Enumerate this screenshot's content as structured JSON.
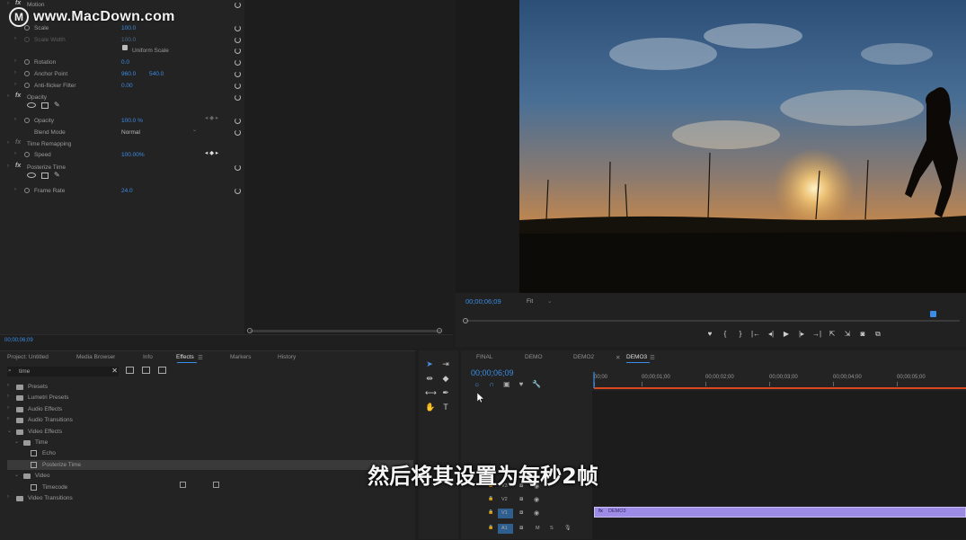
{
  "watermark": {
    "text": "www.MacDown.com"
  },
  "subtitle": "然后将其设置为每秒2帧",
  "effect_controls": {
    "rows": [
      {
        "label": "Motion",
        "value": "",
        "value2": ""
      },
      {
        "label": "Scale",
        "value": "100.0",
        "value2": ""
      },
      {
        "label": "Scale Width",
        "value": "100.0",
        "value2": ""
      },
      {
        "label": "Uniform Scale",
        "value": "",
        "value2": ""
      },
      {
        "label": "Rotation",
        "value": "0.0",
        "value2": ""
      },
      {
        "label": "Anchor Point",
        "value": "960.0",
        "value2": "540.0"
      },
      {
        "label": "Anti-flicker Filter",
        "value": "0.00",
        "value2": ""
      },
      {
        "label": "Opacity",
        "value": "",
        "value2": ""
      },
      {
        "label": "Opacity",
        "value": "100.0 %",
        "value2": ""
      },
      {
        "label": "Blend Mode",
        "value": "Normal",
        "value2": ""
      },
      {
        "label": "Time Remapping",
        "value": "",
        "value2": ""
      },
      {
        "label": "Speed",
        "value": "100.00%",
        "value2": ""
      },
      {
        "label": "Posterize Time",
        "value": "",
        "value2": ""
      },
      {
        "label": "Frame Rate",
        "value": "24.0",
        "value2": ""
      }
    ],
    "timecode": "00;00;06;09"
  },
  "program_monitor": {
    "timecode": "00;00;06;09",
    "fit_label": "Fit"
  },
  "project_panel": {
    "tabs": [
      "Project: Untitled",
      "Media Browser",
      "Info",
      "Effects",
      "Markers",
      "History"
    ],
    "search_value": "time",
    "tree": [
      {
        "label": "Presets",
        "indent": 0,
        "type": "folder"
      },
      {
        "label": "Lumetri Presets",
        "indent": 0,
        "type": "folder"
      },
      {
        "label": "Audio Effects",
        "indent": 0,
        "type": "folder"
      },
      {
        "label": "Audio Transitions",
        "indent": 0,
        "type": "folder"
      },
      {
        "label": "Video Effects",
        "indent": 0,
        "type": "folder"
      },
      {
        "label": "Time",
        "indent": 1,
        "type": "folder"
      },
      {
        "label": "Echo",
        "indent": 2,
        "type": "effect"
      },
      {
        "label": "Posterize Time",
        "indent": 2,
        "type": "effect"
      },
      {
        "label": "Video",
        "indent": 1,
        "type": "folder"
      },
      {
        "label": "Timecode",
        "indent": 2,
        "type": "effect"
      },
      {
        "label": "Video Transitions",
        "indent": 0,
        "type": "folder"
      }
    ]
  },
  "timeline": {
    "tabs": [
      "FINAL",
      "DEMO",
      "DEMO2",
      "DEMO3"
    ],
    "timecode": "00;00;06;09",
    "ruler": [
      "00;00",
      "00;00;01;00",
      "00;00;02;00",
      "00;00;03;00",
      "00;00;04;00",
      "00;00;05;00"
    ],
    "tracks": [
      "V3",
      "V2",
      "V1",
      "A1"
    ],
    "clip_label": "DEMO3",
    "colors": {
      "clip": "#9d8ce6",
      "playhead_bar": "#d9481f",
      "accent": "#3b8ce6"
    }
  }
}
